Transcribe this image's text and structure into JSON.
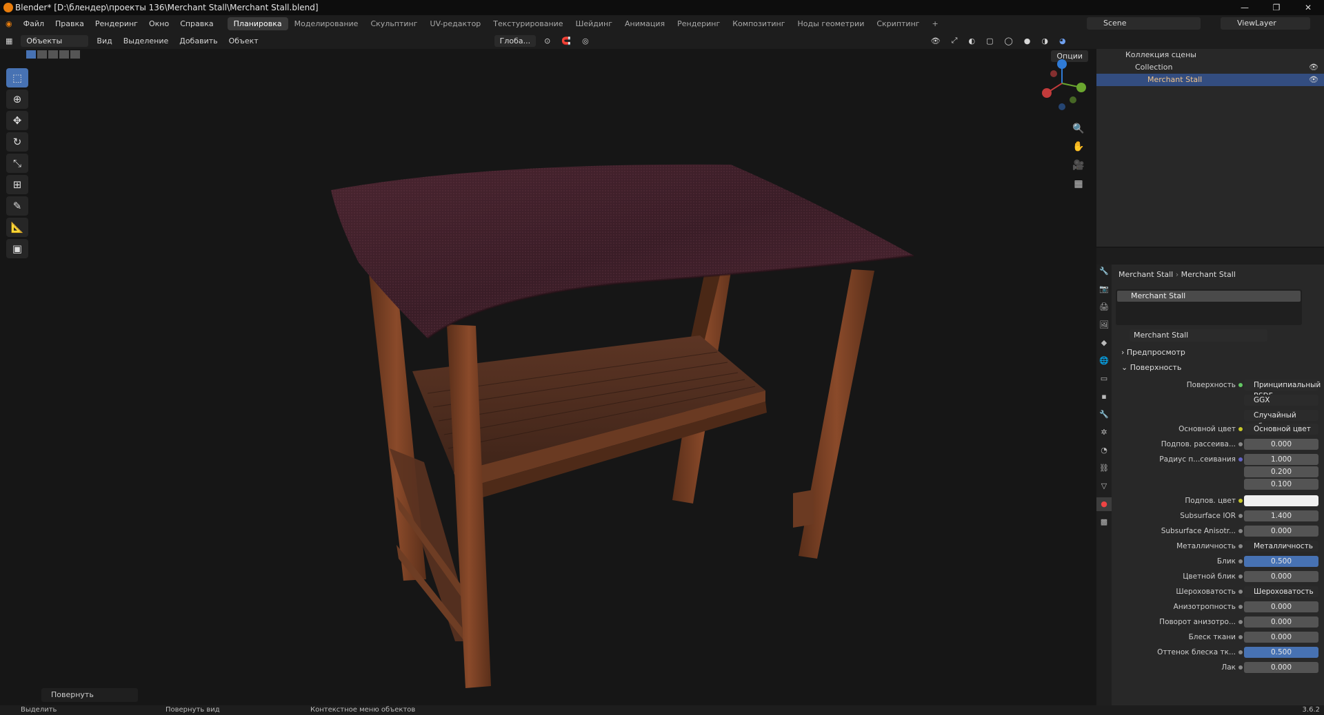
{
  "window": {
    "title": "Blender* [D:\\блендер\\проекты 136\\Merchant Stall\\Merchant Stall.blend]",
    "minimize": "—",
    "maximize": "❐",
    "close": "✕"
  },
  "menu": {
    "items": [
      "Файл",
      "Правка",
      "Рендеринг",
      "Окно",
      "Справка"
    ]
  },
  "workspaces": [
    "Планировка",
    "Моделирование",
    "Скульптинг",
    "UV-редактор",
    "Текстурирование",
    "Шейдинг",
    "Анимация",
    "Рендеринг",
    "Композитинг",
    "Ноды геометрии",
    "Скриптинг",
    "+"
  ],
  "scene": {
    "name": "Scene",
    "view_layer": "ViewLayer"
  },
  "viewport_header": {
    "mode": "Объекты",
    "menus": [
      "Вид",
      "Выделение",
      "Добавить",
      "Объект"
    ],
    "orientation": "Глоба...",
    "options": "Опции"
  },
  "operator_panel": {
    "label": "Повернуть"
  },
  "statusbar": {
    "left": "Выделить",
    "middle": "Повернуть вид",
    "right": "Контекстное меню объектов",
    "version": "3.6.2"
  },
  "outliner": {
    "root": "Коллекция сцены",
    "collection": "Collection",
    "object": "Merchant Stall"
  },
  "properties": {
    "breadcrumb": [
      "Merchant Stall",
      "Merchant Stall"
    ],
    "slot": "Merchant Stall",
    "material": "Merchant Stall",
    "sections": {
      "preview": "Предпросмотр",
      "surface": "Поверхность"
    },
    "surface_label": "Поверхность",
    "surface_value": "Принципиальный BSDF",
    "distribution": "GGX",
    "subsurface_method": "Случайный обход",
    "rows": [
      {
        "label": "Основной цвет",
        "value": "Основной цвет"
      },
      {
        "label": "Подпов. рассеива...",
        "value": "0.000"
      },
      {
        "label": "Радиус п...сеивания",
        "value": "1.000"
      },
      {
        "label": "",
        "value": "0.200"
      },
      {
        "label": "",
        "value": "0.100"
      },
      {
        "label": "Подпов. цвет",
        "value": ""
      },
      {
        "label": "Subsurface IOR",
        "value": "1.400"
      },
      {
        "label": "Subsurface Anisotr...",
        "value": "0.000"
      },
      {
        "label": "Металличность",
        "value": "Металличность"
      },
      {
        "label": "Блик",
        "value": "0.500"
      },
      {
        "label": "Цветной блик",
        "value": "0.000"
      },
      {
        "label": "Шероховатость",
        "value": "Шероховатость"
      },
      {
        "label": "Анизотропность",
        "value": "0.000"
      },
      {
        "label": "Поворот анизотро...",
        "value": "0.000"
      },
      {
        "label": "Блеск ткани",
        "value": "0.000"
      },
      {
        "label": "Оттенок блеска тк...",
        "value": "0.500"
      },
      {
        "label": "Лак",
        "value": "0.000"
      }
    ]
  }
}
